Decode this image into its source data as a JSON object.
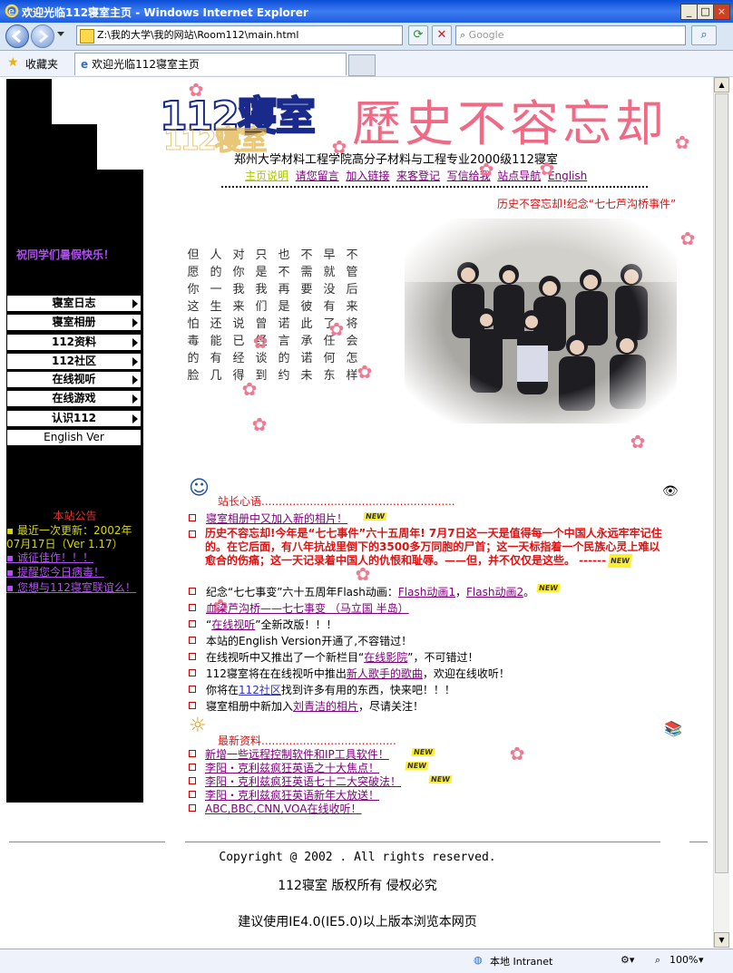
{
  "window": {
    "title": "欢迎光临112寝室主页 - Windows Internet Explorer",
    "address": "Z:\\我的大学\\我的网站\\Room112\\main.html",
    "search_placeholder": "Google",
    "favorites_label": "收藏夹",
    "tab_title": "欢迎光临112寝室主页",
    "status_zone": "本地 Intranet",
    "zoom": "100%"
  },
  "header": {
    "logo_text": "112寝室",
    "banner_text": "歷史不容忘却",
    "subtitle": "郑州大学材料工程学院高分子材料与工程专业2000级112寝室",
    "nav": [
      "主页说明",
      "请您留言",
      "加入链接",
      "来客登记",
      "写信给我",
      "站点导航",
      "English"
    ],
    "marquee": "历史不容忘却!纪念“七七芦沟桥事件”"
  },
  "sidebar": {
    "greeting": "祝同学们暑假快乐！",
    "menu": [
      "寝室日志",
      "寝室相册",
      "112资料",
      "112社区",
      "在线视听",
      "在线游戏",
      "认识112",
      "English Ver"
    ],
    "notice_title": "本站公告",
    "notice_lines": [
      "▪ 最近一次更新：2002年",
      "07月17日（Ver 1.17）"
    ],
    "notice_links": [
      "▪ 诚征佳作！！！",
      "▪ 提醒您今日病毒！",
      "▪ 您想与112寝室联谊么！"
    ]
  },
  "poem": [
    "但愿你这怕毒的脸",
    "人的一生还能有几",
    "对你我来说已经得",
    "只是我们曾经谈到",
    "也不再是诺言的约",
    "不需要彼此承诺未",
    "早就没有了任何东",
    "不管后来将会怎样"
  ],
  "news": {
    "header": "站长心语",
    "items": [
      {
        "text": "寝室相册中又加入新的相片！",
        "link": true,
        "new": true
      },
      {
        "text": "历史不容忘却!今年是“七七事件”六十五周年! 7月7日这一天是值得每一个中国人永远牢牢记住的。在它后面，有八年抗战里倒下的3500多万同胞的尸首；这一天标指着一个民族心灵上难以愈合的伤痛；这一天记录着中国人的仇恨和耻辱。——但，并不仅仅是这些。 ------",
        "bold_red": true,
        "new": true
      },
      {
        "prefix": "纪念“七七事变”六十五周年Flash动画：",
        "link1": "Flash动画1",
        "sep": "，",
        "link2": "Flash动画2",
        "suffix": "。",
        "new": true
      },
      {
        "text": "血染芦沟桥——七七事变 （马立国 半岛）",
        "link": true
      },
      {
        "prefix": "“",
        "link1": "在线视听",
        "suffix": "”全新改版！！！"
      },
      {
        "text": "本站的English Version开通了,不容错过！"
      },
      {
        "prefix": "在线视听中又推出了一个新栏目“",
        "link1": "在线影院",
        "suffix": "”，不可错过！"
      },
      {
        "prefix": "112寝室将在在线视听中推出",
        "link1": "新人歌手的歌曲",
        "suffix": "，欢迎在线收听！"
      },
      {
        "prefix": "你将在",
        "link1": "112社区",
        "suffix": "找到许多有用的东西，快来吧！！！"
      },
      {
        "prefix": "寝室相册中新加入",
        "link1": "刘青洁的相片",
        "suffix": "，尽请关注！"
      }
    ]
  },
  "resources": {
    "header": "最新资料",
    "items": [
      {
        "text": "新增一些远程控制软件和IP工具软件！",
        "new": true
      },
      {
        "text": "李阳・克利兹疯狂英语之十大焦点！",
        "new": true
      },
      {
        "text": "李阳・克利兹疯狂英语七十二大突破法！",
        "new": true
      },
      {
        "text": "李阳・克利兹疯狂英语新年大放送！"
      },
      {
        "text": "ABC,BBC,CNN,VOA在线收听！"
      }
    ]
  },
  "footer": {
    "copyright": "Copyright @ 2002 . All rights reserved.",
    "rights": "112寝室 版权所有 侵权必究",
    "advice": "建议使用IE4.0(IE5.0)以上版本浏览本网页"
  },
  "new_badge": "NEW"
}
